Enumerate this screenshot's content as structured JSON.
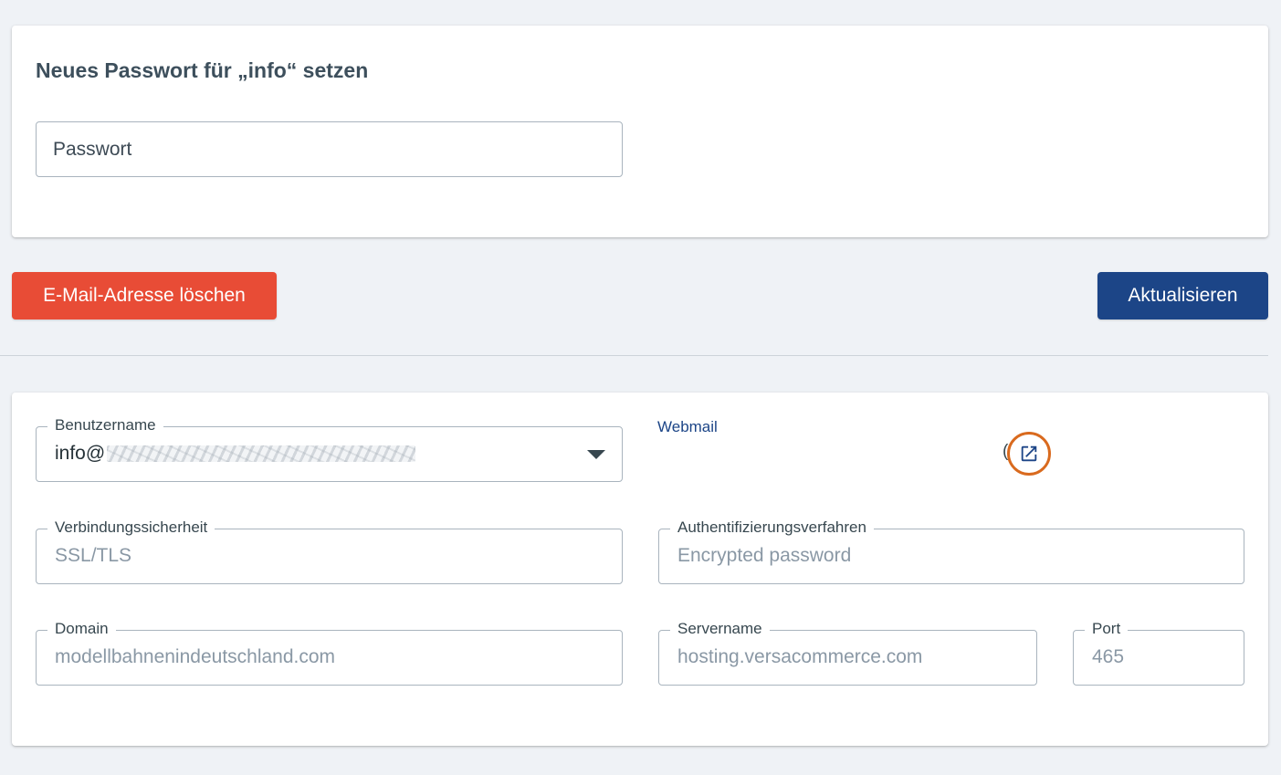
{
  "password_card": {
    "title": "Neues Passwort für „info“ setzen",
    "password_placeholder": "Passwort"
  },
  "actions": {
    "delete_label": "E-Mail-Adresse löschen",
    "update_label": "Aktualisieren"
  },
  "settings": {
    "username": {
      "label": "Benutzername",
      "value": "info@"
    },
    "webmail": {
      "label": "Webmail",
      "icon": "external-link-icon"
    },
    "security": {
      "label": "Verbindungssicherheit",
      "value": "SSL/TLS"
    },
    "auth": {
      "label": "Authentifizierungsverfahren",
      "value": "Encrypted password"
    },
    "domain": {
      "label": "Domain",
      "value": "modellbahnenindeutschland.com"
    },
    "server": {
      "label": "Servername",
      "value": "hosting.versacommerce.com"
    },
    "port": {
      "label": "Port",
      "value": "465"
    }
  },
  "colors": {
    "danger": "#e84c36",
    "primary": "#1c4587",
    "highlight_ring": "#d96a1e",
    "background": "#eff2f6"
  }
}
